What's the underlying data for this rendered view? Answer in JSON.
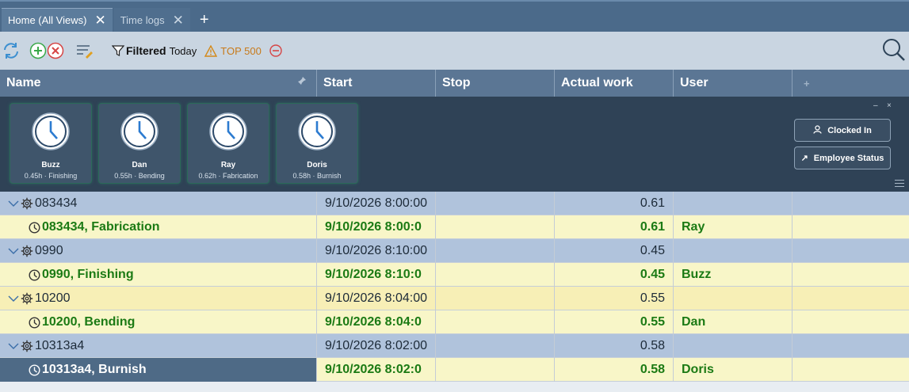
{
  "tabs": [
    {
      "label": "Home (All Views)",
      "active": true
    },
    {
      "label": "Time logs",
      "active": false
    }
  ],
  "toolbar": {
    "filter_label": "Filtered",
    "filter_scope": "Today",
    "top_label": "TOP 500"
  },
  "columns": {
    "name": "Name",
    "start": "Start",
    "stop": "Stop",
    "work": "Actual work",
    "user": "User"
  },
  "panel": {
    "cards": [
      {
        "name": "Buzz",
        "sub": "0.45h · Finishing"
      },
      {
        "name": "Dan",
        "sub": "0.55h · Bending"
      },
      {
        "name": "Ray",
        "sub": "0.62h · Fabrication"
      },
      {
        "name": "Doris",
        "sub": "0.58h · Burnish"
      }
    ],
    "clocked_in": "Clocked In",
    "employee_status": "Employee Status",
    "minimize": "–",
    "close": "×"
  },
  "rows": [
    {
      "type": "group",
      "name": "083434",
      "start": "9/10/2026 8:00:00",
      "stop": "",
      "work": "0.61",
      "user": ""
    },
    {
      "type": "detail",
      "name": "083434, Fabrication",
      "start": "9/10/2026 8:00:0",
      "stop": "",
      "work": "0.61",
      "user": "Ray"
    },
    {
      "type": "group",
      "name": "0990",
      "start": "9/10/2026 8:10:00",
      "stop": "",
      "work": "0.45",
      "user": ""
    },
    {
      "type": "detail",
      "name": "0990, Finishing",
      "start": "9/10/2026 8:10:0",
      "stop": "",
      "work": "0.45",
      "user": "Buzz"
    },
    {
      "type": "group",
      "name": "10200",
      "start": "9/10/2026 8:04:00",
      "stop": "",
      "work": "0.55",
      "user": ""
    },
    {
      "type": "detail",
      "name": "10200, Bending",
      "start": "9/10/2026 8:04:0",
      "stop": "",
      "work": "0.55",
      "user": "Dan"
    },
    {
      "type": "group",
      "name": "10313a4",
      "start": "9/10/2026 8:02:00",
      "stop": "",
      "work": "0.58",
      "user": ""
    },
    {
      "type": "detail",
      "name": "10313a4, Burnish",
      "start": "9/10/2026 8:02:0",
      "stop": "",
      "work": "0.58",
      "user": "Doris"
    }
  ],
  "colors": {
    "accent": "#5b7694",
    "detail_text": "#1b7a14",
    "group_row": "#b0c3dc",
    "detail_row": "#f8f6c8"
  }
}
